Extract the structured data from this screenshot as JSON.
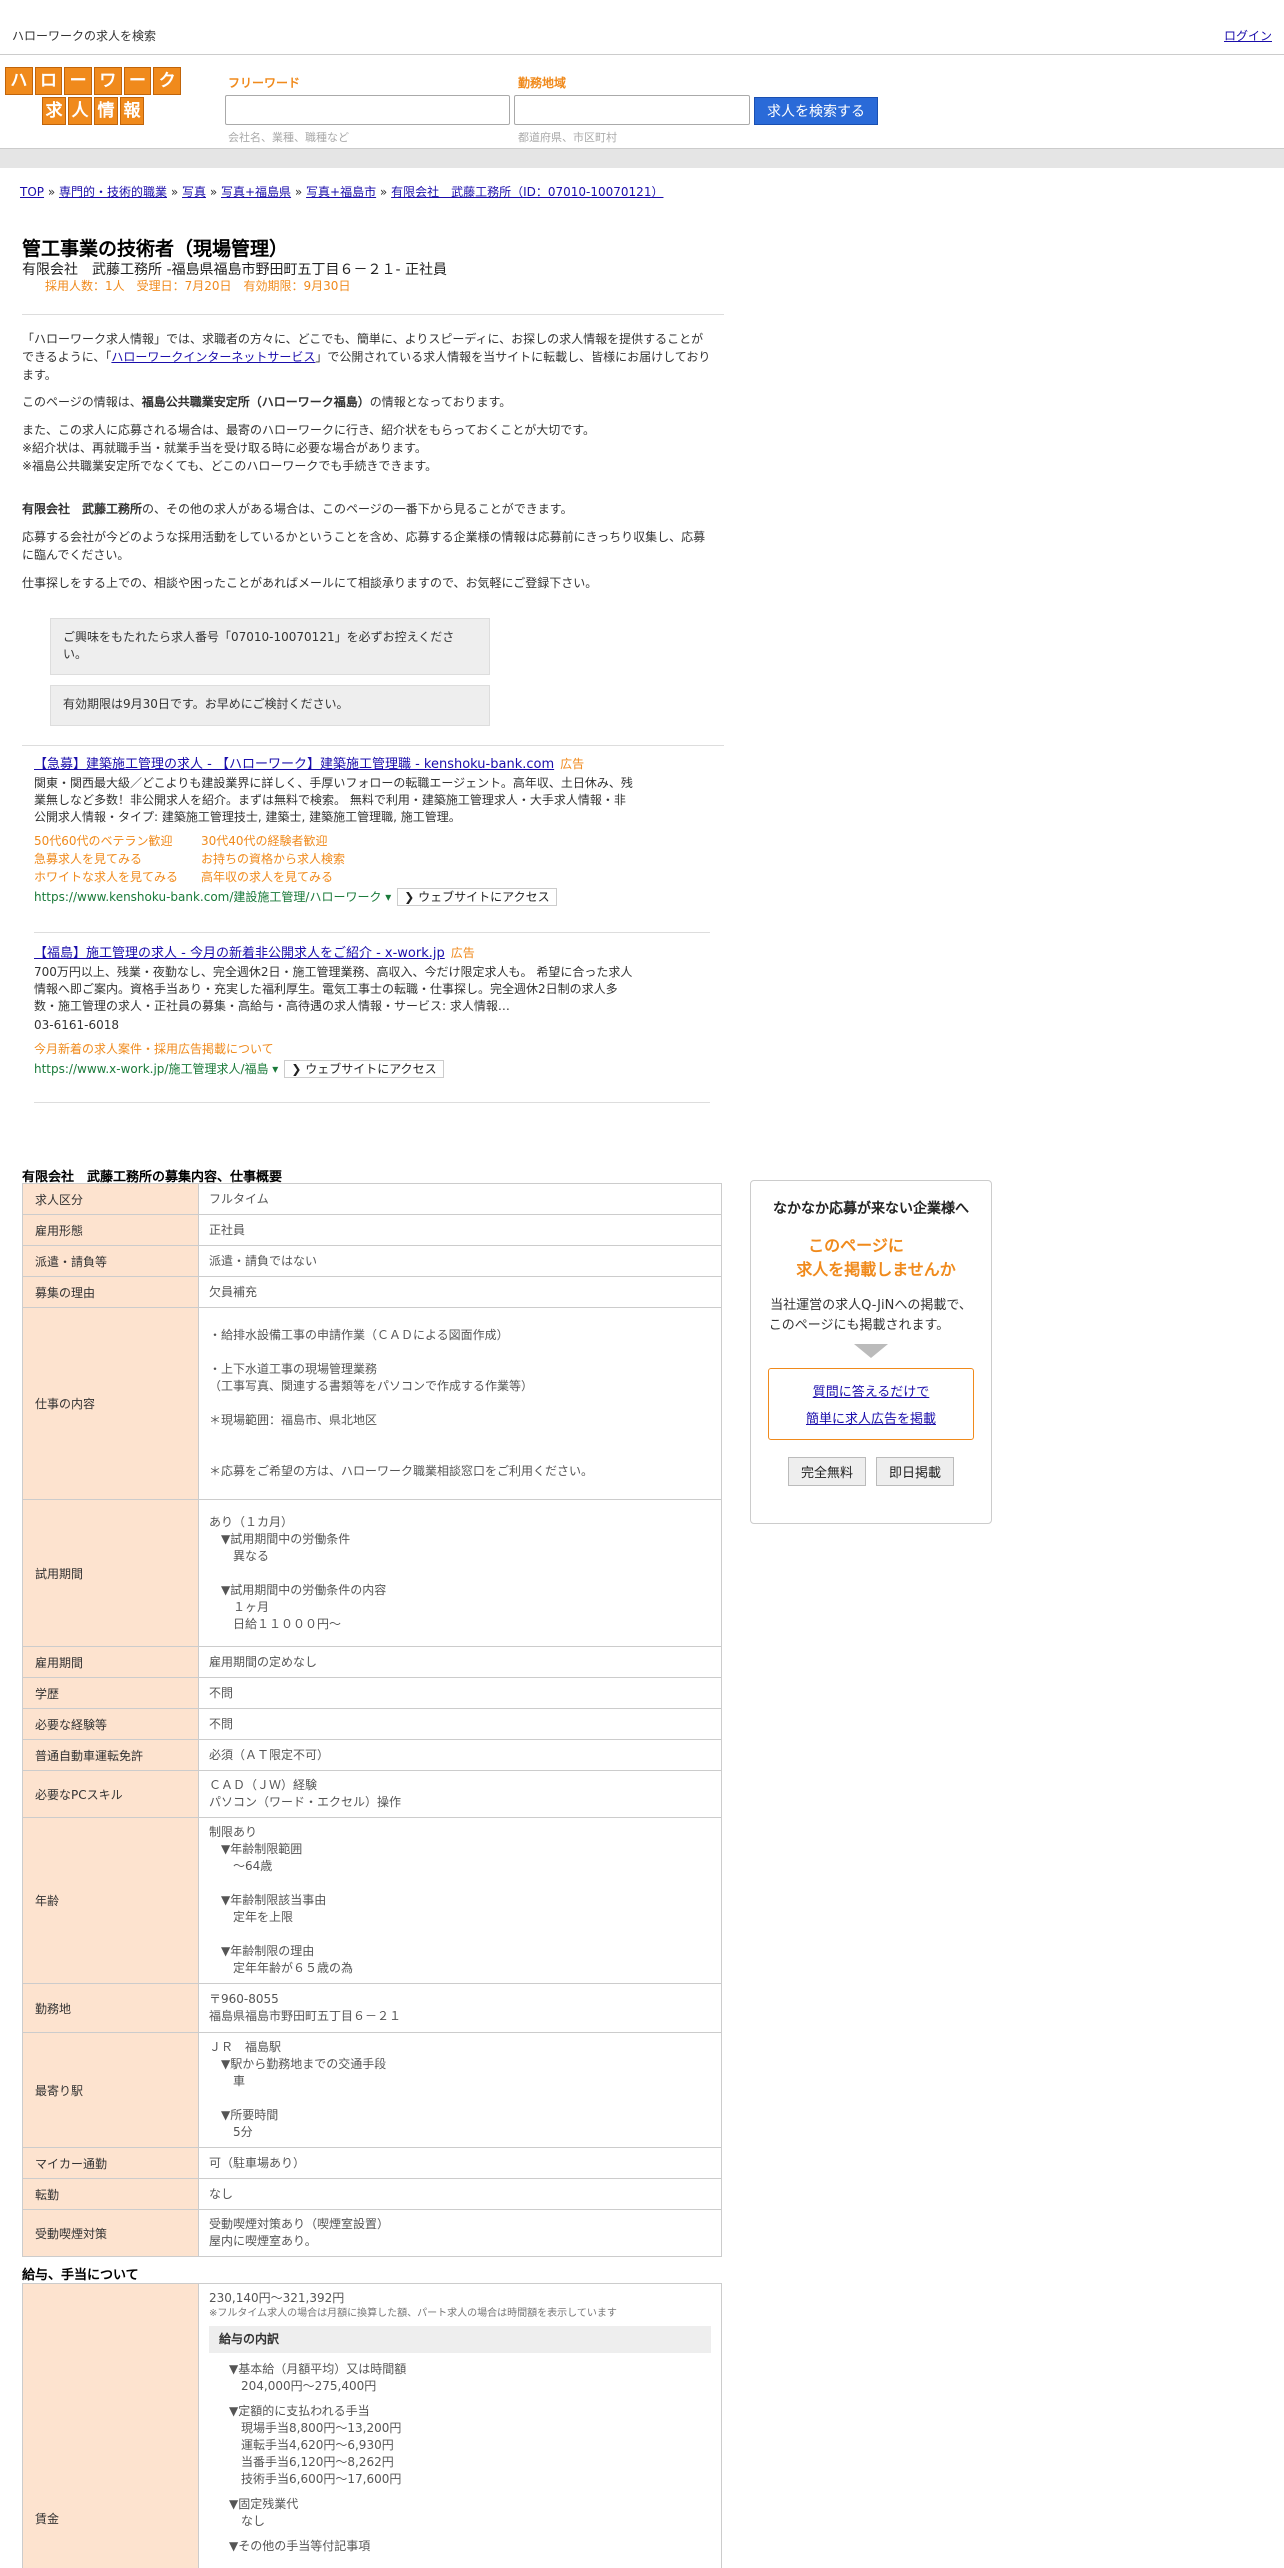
{
  "topbar": {
    "title": "ハローワークの求人を検索",
    "login": "ログイン"
  },
  "logo": {
    "row1": [
      "ハ",
      "ロ",
      "ー",
      "ワ",
      "ー",
      "ク"
    ],
    "row2": [
      "求",
      "人",
      "情",
      "報"
    ]
  },
  "search": {
    "freeword_label": "フリーワード",
    "freeword_hint": "会社名、業種、職種など",
    "area_label": "勤務地域",
    "area_hint": "都道府県、市区町村",
    "button": "求人を検索する"
  },
  "breadcrumb": {
    "items": [
      "TOP",
      "専門的・技術的職業",
      "写真",
      "写真+福島県",
      "写真+福島市",
      "有限会社　武藤工務所（ID：07010-10070121）"
    ],
    "sep": " » "
  },
  "job": {
    "title": "管工事業の技術者（現場管理）",
    "company_line": "有限会社　武藤工務所 -福島県福島市野田町五丁目６－２１- 正社員",
    "meta": "採用人数：1人　受理日：7月20日　有効期限：9月30日"
  },
  "intro": {
    "p1a": "「ハローワーク求人情報」では、求職者の方々に、どこでも、簡単に、よりスピーディに、お探しの求人情報を提供することができるように、「",
    "p1link": "ハローワークインターネットサービス",
    "p1b": "」で公開されている求人情報を当サイトに転載し、皆様にお届けしております。",
    "p2a": "このページの情報は、",
    "p2b": "福島公共職業安定所（ハローワーク福島）",
    "p2c": "の情報となっております。",
    "p3": "また、この求人に応募される場合は、最寄のハローワークに行き、紹介状をもらっておくことが大切です。",
    "p4": "※紹介状は、再就職手当・就業手当を受け取る時に必要な場合があります。",
    "p5": "※福島公共職業安定所でなくても、どこのハローワークでも手続きできます。",
    "p6a": "有限会社　武藤工務所",
    "p6b": "の、その他の求人がある場合は、このページの一番下から見ることができます。",
    "p7": "応募する会社が今どのような採用活動をしているかということを含め、応募する企業様の情報は応募前にきっちり収集し、応募に臨んでください。",
    "p8": "仕事探しをする上での、相談や困ったことがあればメールにて相談承りますので、お気軽にご登録下さい。"
  },
  "notes": {
    "n1": "ご興味をもたれたら求人番号「07010-10070121」を必ずお控えください。",
    "n2": "有効期限は9月30日です。お早めにご検討ください。"
  },
  "ads": [
    {
      "title": "【急募】建築施工管理の求人 - 【ハローワーク】建築施工管理職 - kenshoku-bank.com",
      "tag": "広告",
      "desc": "関東・関西最大級／どこよりも建設業界に詳しく、手厚いフォローの転職エージェント。高年収、土日休み、残業無しなど多数！非公開求人を紹介。まずは無料で検索。 無料で利用・建築施工管理求人・大手求人情報・非公開求人情報・タイプ: 建築施工管理技士, 建築士, 建築施工管理職, 施工管理。",
      "links": [
        "50代60代のベテラン歓迎",
        "30代40代の経験者歓迎",
        "急募求人を見てみる",
        "お持ちの資格から求人検索",
        "ホワイトな求人を見てみる",
        "高年収の求人を見てみる"
      ],
      "url": "https://www.kenshoku-bank.com/建設施工管理/ハローワーク ▾",
      "visit": "❯ ウェブサイトにアクセス"
    },
    {
      "title": "【福島】施工管理の求人 - 今月の新着非公開求人をご紹介 - x-work.jp",
      "tag": "広告",
      "desc": "700万円以上、残業・夜勤なし、完全週休2日・施工管理業務、高収入、今だけ限定求人も。 希望に合った求人情報へ即ご案内。資格手当あり・充実した福利厚生。電気工事士の転職・仕事探し。完全週休2日制の求人多数・施工管理の求人・正社員の募集・高給与・高待遇の求人情報・サービス: 求人情報…",
      "phone": "03-6161-6018",
      "links": [
        "今月新着の求人案件・採用広告掲載について"
      ],
      "url": "https://www.x-work.jp/施工管理求人/福島 ▾",
      "visit": "❯ ウェブサイトにアクセス"
    }
  ],
  "overview": {
    "title": "有限会社　武藤工務所の募集内容、仕事概要",
    "rows": [
      {
        "k": "求人区分",
        "v": [
          "フルタイム"
        ]
      },
      {
        "k": "雇用形態",
        "v": [
          "正社員"
        ]
      },
      {
        "k": "派遣・請負等",
        "v": [
          "派遣・請負ではない"
        ]
      },
      {
        "k": "募集の理由",
        "v": [
          "欠員補充"
        ]
      },
      {
        "k": "仕事の内容",
        "v": [
          "・給排水設備工事の申請作業（ＣＡＤによる図面作成）",
          "",
          "・上下水道工事の現場管理業務",
          "（工事写真、関連する書類等をパソコンで作成する作業等）",
          "",
          "＊現場範囲：福島市、県北地区",
          "",
          "",
          "＊応募をご希望の方は、ハローワーク職業相談窓口をご利用ください。"
        ]
      },
      {
        "k": "試用期間",
        "v": [
          "あり（１カ月）",
          "　▼試用期間中の労働条件",
          "　　異なる",
          "",
          "　▼試用期間中の労働条件の内容",
          "　　１ヶ月",
          "　　日給１１０００円～"
        ]
      },
      {
        "k": "雇用期間",
        "v": [
          "雇用期間の定めなし"
        ]
      },
      {
        "k": "学歴",
        "v": [
          "不問"
        ]
      },
      {
        "k": "必要な経験等",
        "v": [
          "不問"
        ]
      },
      {
        "k": "普通自動車運転免許",
        "v": [
          "必須（ＡＴ限定不可）"
        ]
      },
      {
        "k": "必要なPCスキル",
        "v": [
          "ＣＡＤ（ＪＷ）経験",
          "パソコン（ワード・エクセル）操作"
        ]
      },
      {
        "k": "年齢",
        "v": [
          "制限あり",
          "　▼年齢制限範囲",
          "　　～64歳",
          "",
          "　▼年齢制限該当事由",
          "　　定年を上限",
          "",
          "　▼年齢制限の理由",
          "　　定年年齢が６５歳の為"
        ]
      },
      {
        "k": "勤務地",
        "v": [
          "〒960-8055",
          "福島県福島市野田町五丁目６－２１"
        ]
      },
      {
        "k": "最寄り駅",
        "v": [
          "ＪＲ　福島駅",
          "　▼駅から勤務地までの交通手段",
          "　　車",
          "",
          "　▼所要時間",
          "　　5分"
        ]
      },
      {
        "k": "マイカー通勤",
        "v": [
          "可（駐車場あり）"
        ]
      },
      {
        "k": "転勤",
        "v": [
          "なし"
        ]
      },
      {
        "k": "受動喫煙対策",
        "v": [
          "受動喫煙対策あり（喫煙室設置）",
          "屋内に喫煙室あり。"
        ]
      }
    ]
  },
  "salary": {
    "title": "給与、手当について",
    "key": "賃金",
    "range": "230,140円〜321,392円",
    "note": "※フルタイム求人の場合は月額に換算した額、パート求人の場合は時間額を表示しています",
    "breakdown_label": "給与の内訳",
    "lines": [
      "▼基本給（月額平均）又は時間額",
      "　204,000円〜275,400円",
      "",
      "▼定額的に支払われる手当",
      "　現場手当8,800円〜13,200円",
      "　運転手当4,620円〜6,930円",
      "　当番手当6,120円〜8,262円",
      "　技術手当6,600円〜17,600円",
      "",
      "▼固定残業代",
      "　なし",
      "",
      "▼その他の手当等付記事項"
    ]
  },
  "side": {
    "heading": "なかなか応募が来ない企業様へ",
    "orange1": "このページに",
    "orange2": "求人を掲載しませんか",
    "p1": "当社運営の求人Q-JiNへの掲載で、",
    "p2": "このページにも掲載されます。",
    "link1": "質問に答えるだけで",
    "link2": "簡単に求人広告を掲載",
    "btn1": "完全無料",
    "btn2": "即日掲載"
  }
}
